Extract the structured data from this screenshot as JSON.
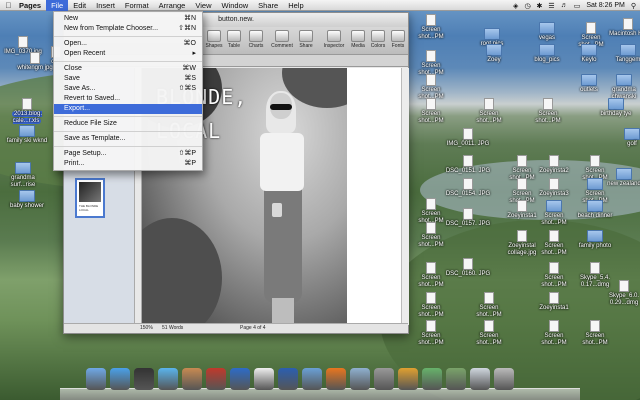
{
  "menubar": {
    "app_name": "Pages",
    "items": [
      "File",
      "Edit",
      "Insert",
      "Format",
      "Arrange",
      "View",
      "Window",
      "Share",
      "Help"
    ],
    "active": "File",
    "clock": "Sat 8:26 PM"
  },
  "window": {
    "title": "button.new.",
    "toolbar": [
      "View",
      "Sections",
      "Text Box",
      "Shapes",
      "Table",
      "Charts",
      "Comment",
      "Share",
      "Inspector",
      "Media",
      "Colors",
      "Fonts"
    ]
  },
  "file_menu": {
    "items": [
      {
        "label": "New",
        "shortcut": "⌘N"
      },
      {
        "label": "New from Template Chooser...",
        "shortcut": "⇧⌘N"
      },
      {
        "label": "Open...",
        "shortcut": "⌘O"
      },
      {
        "label": "Open Recent",
        "shortcut": "▸"
      },
      {
        "label": "Close",
        "shortcut": "⌘W"
      },
      {
        "label": "Save",
        "shortcut": "⌘S"
      },
      {
        "label": "Save As...",
        "shortcut": "⇧⌘S"
      },
      {
        "label": "Revert to Saved...",
        "shortcut": ""
      },
      {
        "label": "Export...",
        "shortcut": ""
      },
      {
        "label": "Reduce File Size",
        "shortcut": ""
      },
      {
        "label": "Save as Template...",
        "shortcut": ""
      },
      {
        "label": "Page Setup...",
        "shortcut": "⇧⌘P"
      },
      {
        "label": "Print...",
        "shortcut": "⌘P"
      }
    ],
    "highlighted": "Export..."
  },
  "document": {
    "headline_line1": "BLONDE,",
    "headline_line2": "LOCAL",
    "thumb_text": "THE BLONDE LOCAL",
    "zoom": "150%",
    "word_count": "51 Words",
    "page_indicator": "Page 4 of 4"
  },
  "desktop_icons": [
    {
      "label": "Screen shot...PM"
    },
    {
      "label": "root pics"
    },
    {
      "label": "vegas"
    },
    {
      "label": "Screen shot...PM"
    },
    {
      "label": "Macintosh HD"
    },
    {
      "label": "IMG_0370 jpg"
    },
    {
      "label": "whitengm jpg"
    },
    {
      "label": "crui"
    },
    {
      "label": "Zoey"
    },
    {
      "label": "blog_pics"
    },
    {
      "label": "Keylo"
    },
    {
      "label": "Tanggem"
    },
    {
      "label": "2013.blog. cale...r.xls"
    },
    {
      "label": "Screen shot...PM"
    },
    {
      "label": "Screen shot...PM"
    },
    {
      "label": "outlets"
    },
    {
      "label": "grandma chwanski"
    },
    {
      "label": "family ski wknd"
    },
    {
      "label": "IMG_0011. JPG"
    },
    {
      "label": "Screen shot...PM"
    },
    {
      "label": "Screen shot...PM"
    },
    {
      "label": "Screen shot...PM"
    },
    {
      "label": "birthday tye"
    },
    {
      "label": "grandma surf...rise"
    },
    {
      "label": "DSC_0151. JPG"
    },
    {
      "label": "Screen shot...PM"
    },
    {
      "label": "Zoeyinsta2"
    },
    {
      "label": "Screen shot...PM"
    },
    {
      "label": "golf"
    },
    {
      "label": "baby shower"
    },
    {
      "label": "DSC_0154. JPG"
    },
    {
      "label": "Screen shot...PM"
    },
    {
      "label": "Zoeyinsta3"
    },
    {
      "label": "Screen shot...PM"
    },
    {
      "label": "new zealand"
    },
    {
      "label": "Screen shot...PM"
    },
    {
      "label": "Zoeyinsta1"
    },
    {
      "label": "Screen shot...PM"
    },
    {
      "label": "beach dinner"
    },
    {
      "label": "DSC_0157. JPG"
    },
    {
      "label": "Screen shot...PM"
    },
    {
      "label": "Zoeyinstal collage.jpg"
    },
    {
      "label": "Screen shot...PM"
    },
    {
      "label": "family photo"
    },
    {
      "label": "DSC_0160. JPG"
    },
    {
      "label": "Screen shot...PM"
    },
    {
      "label": "Screen shot...PM"
    },
    {
      "label": "Skype_5.4. 0.17...dmg"
    },
    {
      "label": "Screen shot...PM"
    },
    {
      "label": "Screen shot...PM"
    },
    {
      "label": "Zoeyinsta1"
    },
    {
      "label": "Skype_6.0. 0.29...dmg"
    },
    {
      "label": "Screen shot...PM"
    },
    {
      "label": "Screen shot...PM"
    },
    {
      "label": "Screen shot...PM"
    },
    {
      "label": "Screen shot...PM"
    }
  ],
  "dock_icons": [
    "finder-icon",
    "app-store-icon",
    "launchpad-icon",
    "safari-icon",
    "contacts-icon",
    "photo-booth-icon",
    "itunes-icon",
    "calendar-icon",
    "word-icon",
    "iphoto-icon",
    "firefox-icon",
    "preview-icon",
    "textedit-icon",
    "pages-icon",
    "messages-icon",
    "grapher-icon",
    "finder-window-icon",
    "trash-icon"
  ]
}
